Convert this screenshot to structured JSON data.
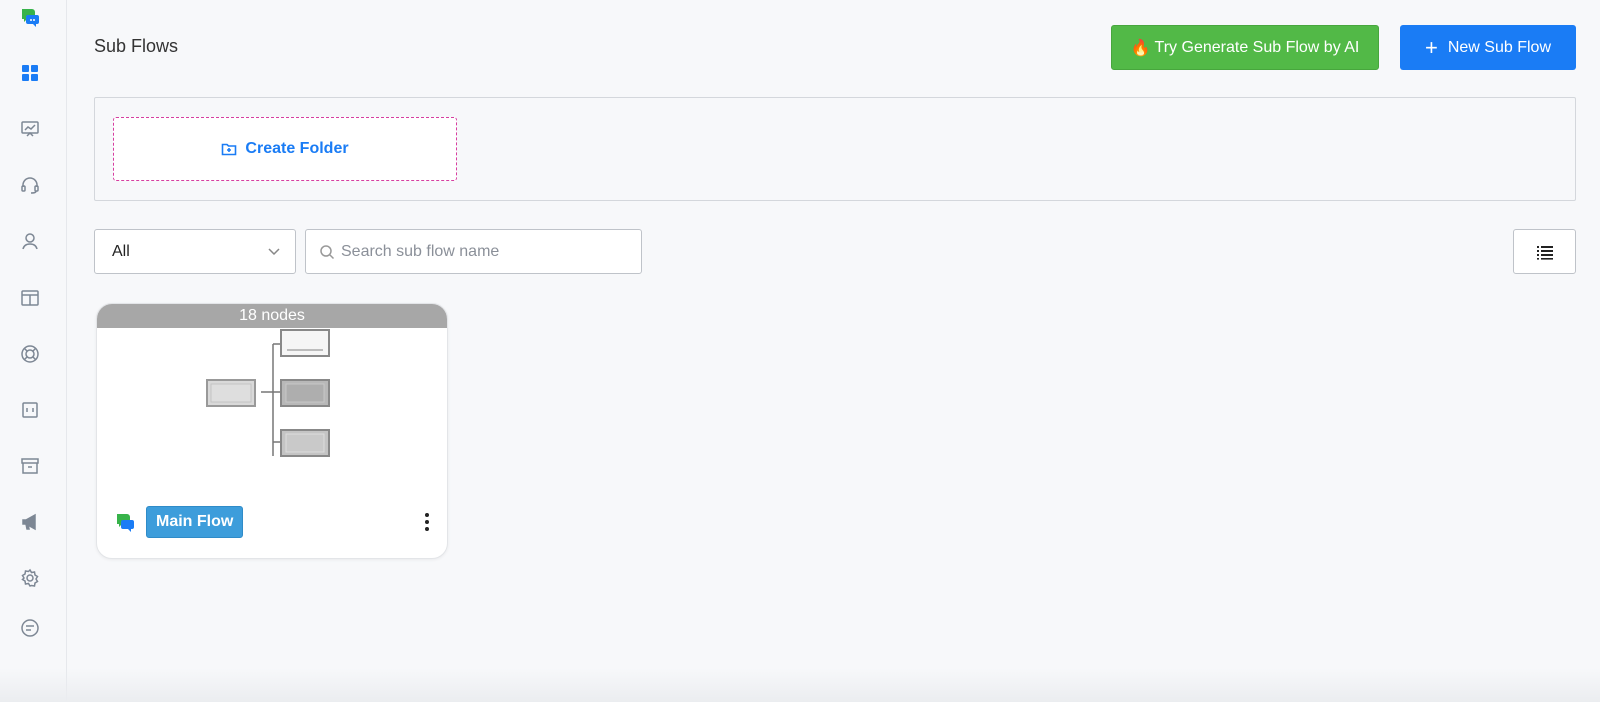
{
  "sidebar": {
    "items": [
      {
        "icon": "app-logo-icon"
      },
      {
        "icon": "dashboard-icon",
        "active": true
      },
      {
        "icon": "analytics-icon"
      },
      {
        "icon": "headset-icon"
      },
      {
        "icon": "user-icon"
      },
      {
        "icon": "layout-icon"
      },
      {
        "icon": "lifebuoy-icon"
      },
      {
        "icon": "id-card-icon"
      },
      {
        "icon": "archive-icon"
      },
      {
        "icon": "megaphone-icon"
      },
      {
        "icon": "gear-icon"
      },
      {
        "icon": "chat-icon"
      }
    ]
  },
  "header": {
    "title": "Sub Flows",
    "ai_button_emoji": "🔥",
    "ai_button_label": "Try Generate Sub Flow by AI",
    "new_button_label": "New Sub Flow"
  },
  "folders": {
    "create_label": "Create Folder"
  },
  "filters": {
    "select_value": "All",
    "search_placeholder": "Search sub flow name"
  },
  "cards": [
    {
      "nodes_label": "18 nodes",
      "name": "Main Flow"
    }
  ],
  "colors": {
    "primary": "#1a7cf5",
    "ai_green": "#52b947",
    "badge_blue": "#3d9ddb",
    "folder_dash": "#d63fa0"
  }
}
